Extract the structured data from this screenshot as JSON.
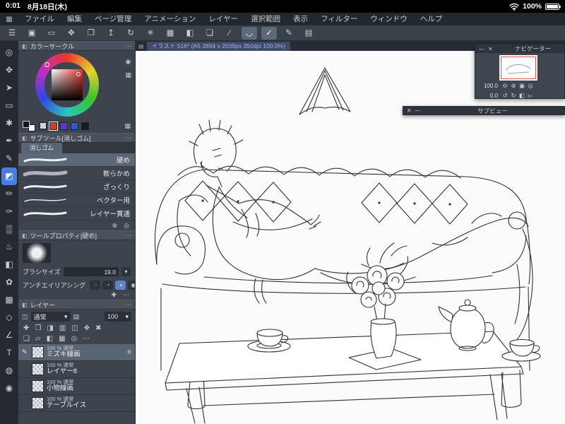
{
  "status_bar": {
    "time": "0:01",
    "date": "8月18日(木)",
    "battery_percent": "100%"
  },
  "menu_bar": {
    "items": [
      {
        "label": "ファイル"
      },
      {
        "label": "編集"
      },
      {
        "label": "ページ管理"
      },
      {
        "label": "アニメーション"
      },
      {
        "label": "レイヤー"
      },
      {
        "label": "選択範囲"
      },
      {
        "label": "表示"
      },
      {
        "label": "フィルター"
      },
      {
        "label": "ウィンドウ"
      },
      {
        "label": "ヘルプ"
      }
    ]
  },
  "toolbar": {
    "icons": [
      {
        "name": "main-menu-icon",
        "glyph": "☰"
      },
      {
        "name": "object-select-icon",
        "glyph": "▣",
        "blue": true
      },
      {
        "name": "marquee-icon",
        "glyph": "▭"
      },
      {
        "name": "layer-move-icon",
        "glyph": "✥"
      },
      {
        "name": "import-icon",
        "glyph": "❒"
      },
      {
        "name": "export-icon",
        "glyph": "↥"
      },
      {
        "name": "rotate-canvas-icon",
        "glyph": "↻"
      },
      {
        "name": "special-ruler-icon",
        "glyph": "✳"
      },
      {
        "name": "grid-snap-icon",
        "glyph": "▦"
      },
      {
        "name": "bucket-icon",
        "glyph": "◧"
      },
      {
        "name": "frame-border-icon",
        "glyph": "❏"
      },
      {
        "name": "straight-line-icon",
        "glyph": "∕"
      },
      {
        "name": "curve-line-icon",
        "glyph": "◡",
        "active": true
      },
      {
        "name": "check-curve-icon",
        "glyph": "✓",
        "active": true
      },
      {
        "name": "correct-line-icon",
        "glyph": "✎"
      },
      {
        "name": "workspace-panel-icon",
        "glyph": "▤"
      }
    ]
  },
  "tab_bar": {
    "panel_glyph": "▤",
    "tab_label": "イラスト 516* (A5 2894 x 2039px 350dpi 100.0%)"
  },
  "tool_strip": {
    "tools": [
      {
        "name": "zoom-tool-icon",
        "glyph": "◎"
      },
      {
        "name": "move-tool-icon",
        "glyph": "✥"
      },
      {
        "name": "object-tool-icon",
        "glyph": "➤"
      },
      {
        "name": "selection-tool-icon",
        "glyph": "▭"
      },
      {
        "name": "lasso-tool-icon",
        "glyph": "✱"
      },
      {
        "name": "eyedropper-tool-icon",
        "glyph": "✒"
      },
      {
        "name": "pen-tool-icon",
        "glyph": "✎"
      },
      {
        "name": "eraser-tool-icon",
        "glyph": "◩",
        "active": true
      },
      {
        "name": "pencil-tool-icon",
        "glyph": "✏"
      },
      {
        "name": "brush-tool-icon",
        "glyph": "✑"
      },
      {
        "name": "airbrush-tool-icon",
        "glyph": "▒"
      },
      {
        "name": "blend-tool-icon",
        "glyph": "♨"
      },
      {
        "name": "fill-tool-icon",
        "glyph": "◧"
      },
      {
        "name": "decoration-tool-icon",
        "glyph": "✿",
        "pink": true
      },
      {
        "name": "gradient-tool-icon",
        "glyph": "▩"
      },
      {
        "name": "figure-tool-icon",
        "glyph": "◇"
      },
      {
        "name": "ruler-tool-icon",
        "glyph": "∠"
      },
      {
        "name": "text-tool-icon",
        "glyph": "T"
      },
      {
        "name": "balloon-tool-icon",
        "glyph": "◍"
      },
      {
        "name": "eye-tool-icon",
        "glyph": "◉"
      }
    ]
  },
  "color_panel": {
    "title": "カラーサークル",
    "side_icons": [
      {
        "name": "color-mixer-icon",
        "glyph": "◉"
      },
      {
        "name": "color-set-icon",
        "glyph": "▦"
      }
    ],
    "chips": [
      {
        "name": "swatch-red",
        "color": "#d93a2b",
        "selected": true
      },
      {
        "name": "swatch-violet",
        "color": "#5a3bd0"
      },
      {
        "name": "swatch-blue",
        "color": "#2b57d8"
      },
      {
        "name": "swatch-black",
        "color": "#17181c"
      }
    ]
  },
  "subtool_panel": {
    "title": "サブツール[消しゴム]",
    "group_label": "消しゴム",
    "items": [
      {
        "label": "硬め",
        "selected": true
      },
      {
        "label": "軟らかめ",
        "soft": true
      },
      {
        "label": "ざっくり",
        "rough": true
      },
      {
        "label": "ベクター用",
        "thin": true
      },
      {
        "label": "レイヤー貫通"
      }
    ]
  },
  "tool_property_panel": {
    "title": "ツールプロパティ[硬め]",
    "brush_size_label": "ブラシサイズ",
    "brush_size_value": "19.0",
    "antialias_label": "アンチエイリアシング",
    "antialias_options": [
      {
        "name": "aa-none",
        "glyph": "◌"
      },
      {
        "name": "aa-weak",
        "glyph": "◔"
      },
      {
        "name": "aa-middle",
        "glyph": "◑",
        "active": true
      },
      {
        "name": "aa-strong",
        "glyph": "◉"
      }
    ]
  },
  "layer_panel": {
    "title": "レイヤー",
    "blend_mode": "通常",
    "opacity_value": "100",
    "icon_row_a": [
      {
        "name": "new-layer-icon",
        "glyph": "✚"
      },
      {
        "name": "new-folder-icon",
        "glyph": "❒"
      },
      {
        "name": "transfer-icon",
        "glyph": "◨"
      },
      {
        "name": "merge-down-icon",
        "glyph": "▥"
      },
      {
        "name": "layer-mask-icon",
        "glyph": "◫"
      },
      {
        "name": "layer-move-icon",
        "glyph": "✥"
      },
      {
        "name": "delete-layer-icon",
        "glyph": "✖"
      }
    ],
    "icon_row_b": [
      {
        "name": "clip-at-layer-icon",
        "glyph": "❏"
      },
      {
        "name": "reference-layer-icon",
        "glyph": "▱"
      },
      {
        "name": "lock-layer-icon",
        "glyph": "◧"
      },
      {
        "name": "lock-alpha-icon",
        "glyph": "▦"
      },
      {
        "name": "enable-mask-icon",
        "glyph": "◎"
      },
      {
        "name": "layer-more-icon",
        "glyph": "⋯"
      }
    ],
    "layers": [
      {
        "meta": "100 % 通常",
        "name": "ミズキ線画",
        "selected": true
      },
      {
        "meta": "100 % 通常",
        "name": "レイヤー8"
      },
      {
        "meta": "100 % 通常",
        "name": "小物線画"
      },
      {
        "meta": "100 % 通常",
        "name": "テーブルイス"
      }
    ]
  },
  "navigator": {
    "title": "ナビゲーター",
    "zoom_value": "100.0",
    "rotate_value": "0.0",
    "zoom_icons": [
      {
        "name": "zoom-out-icon",
        "glyph": "⊖"
      },
      {
        "name": "zoom-in-icon",
        "glyph": "⊕"
      },
      {
        "name": "fit-screen-icon",
        "glyph": "▣"
      },
      {
        "name": "actual-size-icon",
        "glyph": "◎"
      }
    ],
    "rotate_icons": [
      {
        "name": "rotate-ccw-icon",
        "glyph": "↺"
      },
      {
        "name": "rotate-cw-icon",
        "glyph": "↻"
      },
      {
        "name": "flip-horizontal-icon",
        "glyph": "◧"
      },
      {
        "name": "reset-rotation-icon",
        "glyph": "▻"
      }
    ]
  },
  "subview": {
    "title": "サブビュー"
  },
  "icons": {
    "app_grid": "▦",
    "minimize": "—",
    "close": "✕",
    "more": "⋯",
    "dropdown": "▾",
    "plus_circle": "⊕",
    "search": "◎",
    "add": "✚",
    "mode": "◫",
    "brush_small": "▤",
    "pen": "✎",
    "handle": "≡"
  }
}
